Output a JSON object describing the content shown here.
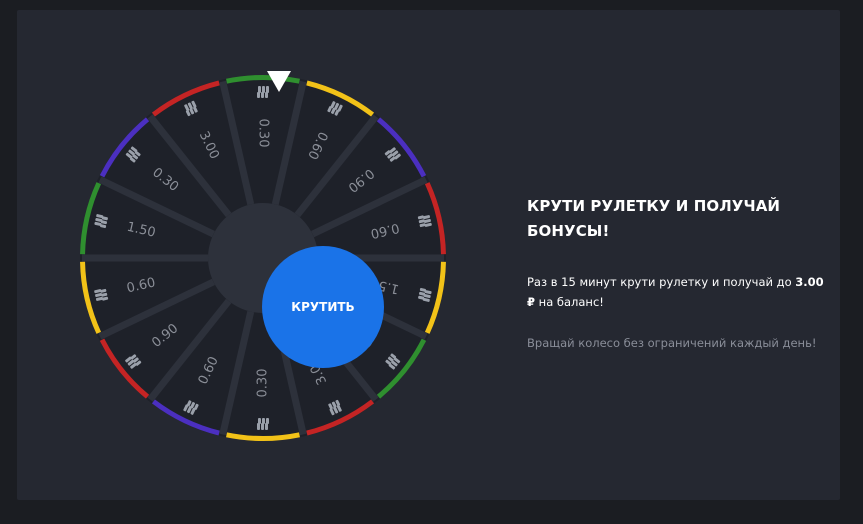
{
  "spin_button_label": "КРУТИТЬ",
  "title": "КРУТИ РУЛЕТКУ И ПОЛУЧАЙ БОНУСЫ!",
  "description": {
    "prefix": "Раз в 15 минут крути рулетку и получай до",
    "amount": "3.00 ₽",
    "suffix": "на баланс!"
  },
  "note": "Вращай колесо без ограничений каждый день!",
  "colors": {
    "background": "#1b1d22",
    "card": "#252831",
    "segment": "#1e2129",
    "divider": "#2d313b",
    "button": "#1a73e8",
    "label": "#8b8f98",
    "rim": [
      "#2f8f2f",
      "#f2c218",
      "#4b2fc0",
      "#c42424"
    ]
  },
  "icons": {
    "coin": "coin-stack-icon",
    "pointer": "pointer-triangle-icon"
  },
  "segments": [
    {
      "value": "0.30",
      "rim": "green"
    },
    {
      "value": "0.60",
      "rim": "yellow"
    },
    {
      "value": "0.90",
      "rim": "purple"
    },
    {
      "value": "0.60",
      "rim": "red"
    },
    {
      "value": "1.50",
      "rim": "yellow"
    },
    {
      "value": "0.30",
      "rim": "green"
    },
    {
      "value": "3.00",
      "rim": "red"
    },
    {
      "value": "0.30",
      "rim": "yellow"
    },
    {
      "value": "0.60",
      "rim": "purple"
    },
    {
      "value": "0.90",
      "rim": "red"
    },
    {
      "value": "0.60",
      "rim": "yellow"
    },
    {
      "value": "1.50",
      "rim": "green"
    },
    {
      "value": "0.30",
      "rim": "purple"
    },
    {
      "value": "3.00",
      "rim": "red"
    }
  ]
}
